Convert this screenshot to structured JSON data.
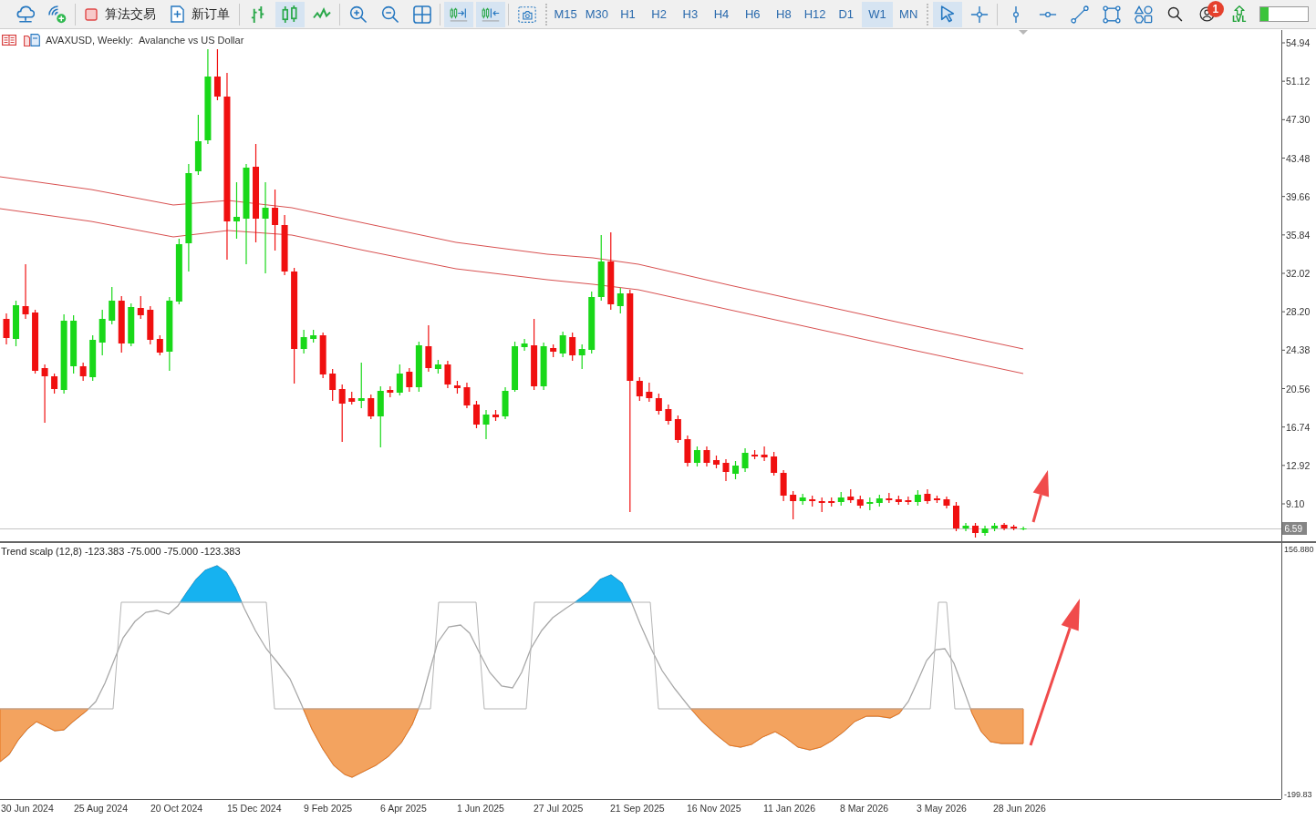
{
  "toolbar": {
    "algo_trading": {
      "label": "算法交易",
      "on": false
    },
    "new_order": {
      "label": "新订单"
    },
    "chart_type_buttons": [
      {
        "selected": false
      },
      {
        "selected": true
      },
      {
        "selected": false
      }
    ],
    "scroll_buttons": [
      {
        "selected": true
      },
      {
        "selected": true
      }
    ],
    "timeframes": [
      {
        "label": "M15",
        "selected": false
      },
      {
        "label": "M30",
        "selected": false
      },
      {
        "label": "H1",
        "selected": false
      },
      {
        "label": "H2",
        "selected": false
      },
      {
        "label": "H3",
        "selected": false
      },
      {
        "label": "H4",
        "selected": false
      },
      {
        "label": "H6",
        "selected": false
      },
      {
        "label": "H8",
        "selected": false
      },
      {
        "label": "H12",
        "selected": false
      },
      {
        "label": "D1",
        "selected": false
      },
      {
        "label": "W1",
        "selected": true
      },
      {
        "label": "MN",
        "selected": false
      }
    ],
    "pointer_buttons": [
      {
        "selected": true
      },
      {
        "selected": false
      }
    ],
    "notification_badge": "1",
    "level_button": {
      "label": "LVL"
    },
    "level_meter": {
      "level": 0.16
    }
  },
  "chart": {
    "symbol": "AVAXUSD, Weekly:",
    "description": "Avalanche vs US Dollar",
    "price_axis": [
      "54.94",
      "51.12",
      "47.30",
      "43.48",
      "39.66",
      "35.84",
      "32.02",
      "28.20",
      "24.38",
      "20.56",
      "16.74",
      "12.92",
      "9.10"
    ],
    "current_price": "6.59"
  },
  "indicator": {
    "title": "Trend scalp (12,8) -123.383 -75.000 -75.000 -123.383",
    "axis": [
      "156.880",
      "-199.83"
    ]
  },
  "time_axis": [
    "30 Jun 2024",
    "25 Aug 2024",
    "20 Oct 2024",
    "15 Dec 2024",
    "9 Feb 2025",
    "6 Apr 2025",
    "1 Jun 2025",
    "27 Jul 2025",
    "21 Sep 2025",
    "16 Nov 2025",
    "11 Jan 2026",
    "8 Mar 2026",
    "3 May 2026",
    "28 Jun 2026"
  ]
}
